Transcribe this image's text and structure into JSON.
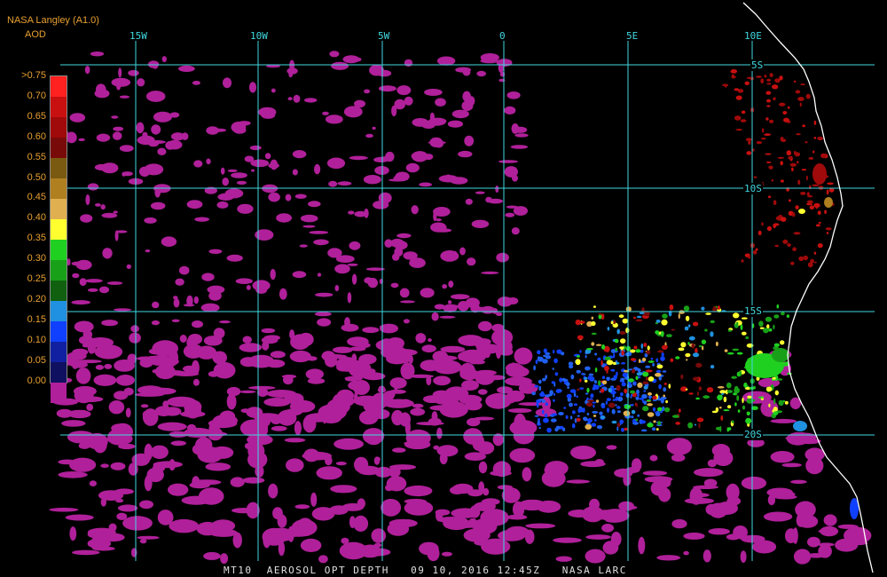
{
  "header": {
    "source": "NASA Langley (A1.0)",
    "product": "AOD"
  },
  "longitude_labels": [
    "15W",
    "10W",
    "5W",
    "0",
    "5E",
    "10E"
  ],
  "latitude_labels": [
    "5S",
    "10S",
    "15S",
    "20S"
  ],
  "colorbar": {
    "labels": [
      ">0.75",
      "0.70",
      "0.65",
      "0.60",
      "0.55",
      "0.50",
      "0.45",
      "0.40",
      "0.35",
      "0.30",
      "0.25",
      "0.20",
      "0.15",
      "0.10",
      "0.05",
      "0.00"
    ],
    "colors": [
      "#ff2020",
      "#c81010",
      "#a00a0a",
      "#780a0a",
      "#7a5a10",
      "#b08020",
      "#e0b050",
      "#ffff30",
      "#20d020",
      "#18a018",
      "#106010",
      "#2090e0",
      "#1040ff",
      "#1020a0",
      "#101060",
      "#b0209a"
    ]
  },
  "footer": "MT10  AEROSOL OPT DEPTH   09 10, 2016 12:45Z   NASA LARC",
  "colors": {
    "grid": "#40d8e0",
    "low_aod": "#b0209a",
    "coast": "#ffffff"
  }
}
